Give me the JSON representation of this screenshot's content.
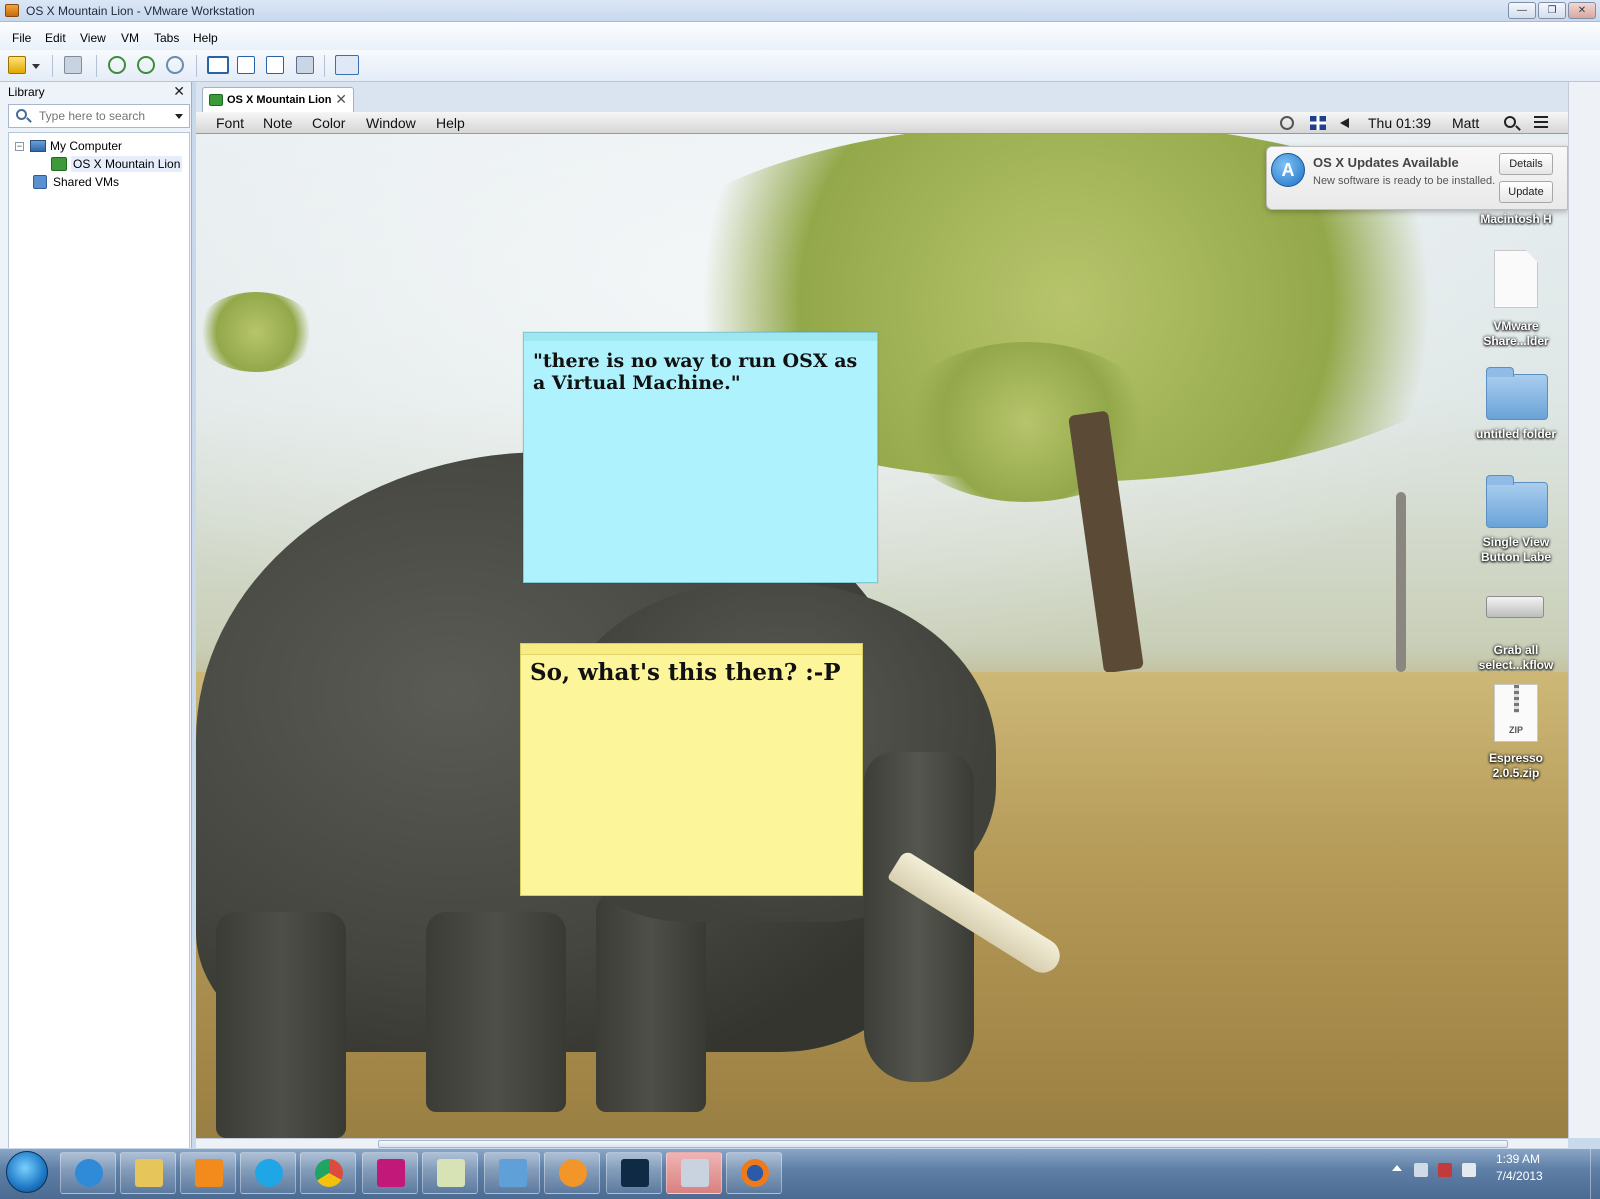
{
  "window": {
    "title": "OS X Mountain Lion - VMware Workstation",
    "buttons": {
      "minimize": "—",
      "maximize": "❐",
      "close": "✕"
    }
  },
  "menu": [
    "File",
    "Edit",
    "View",
    "VM",
    "Tabs",
    "Help"
  ],
  "library": {
    "header": "Library",
    "close": "✕",
    "search_placeholder": "Type here to search",
    "tree": {
      "root": "My Computer",
      "child": "OS X Mountain Lion",
      "shared": "Shared VMs",
      "collapse": "−"
    }
  },
  "tab": {
    "label": "OS X Mountain Lion",
    "close": "✕"
  },
  "osx": {
    "menus": [
      "Font",
      "Note",
      "Color",
      "Window",
      "Help"
    ],
    "clock": "Thu 01:39",
    "user": "Matt"
  },
  "notification": {
    "title": "OS X Updates Available",
    "body": "New software is ready to be installed.",
    "details": "Details",
    "update": "Update"
  },
  "desktop_icons": {
    "hd": "Macintosh H",
    "shared_folder": "VMware Share...lder",
    "untitled": "untitled folder",
    "single_view": "Single View Button Labe",
    "grab": "Grab all select...kflow",
    "zip": "Espresso 2.0.5.zip",
    "zip_badge": "ZIP"
  },
  "notes": {
    "blue": "\"there is no way to run OSX as a Virtual Machine.\"",
    "yellow": "So, what's this then? :-P"
  },
  "taskbar": {
    "time": "1:39 AM",
    "date": "7/4/2013"
  },
  "colors": {
    "sticky_blue": "#aef2fd",
    "sticky_yellow": "#fdf59a",
    "taskbar": "#5f7fa6"
  },
  "icons": [
    "vmware-icon",
    "search-icon",
    "computer-icon",
    "vm-icon",
    "shared-vms-icon",
    "history-icon",
    "flag-icon",
    "speaker-icon",
    "spotlight-icon",
    "notification-center-icon",
    "app-store-icon",
    "start-orb-icon"
  ]
}
